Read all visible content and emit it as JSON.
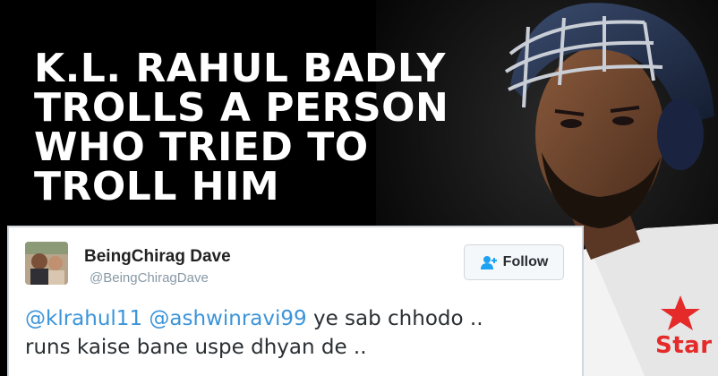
{
  "headline": {
    "lines": [
      "K.L. RAHUL BADLY",
      "TROLLS A PERSON",
      "WHO TRIED TO",
      "TROLL HIM"
    ]
  },
  "tweet": {
    "display_name": "BeingChirag Dave",
    "handle": "@BeingChiragDave",
    "follow_label": "Follow",
    "mention_1": "@klrahul11",
    "mention_2": "@ashwinravi99",
    "text_1": " ye sab chhodo ..",
    "text_2": "runs kaise bane uspe dhyan de .."
  },
  "photo": {
    "jersey_logo_text": "Star"
  },
  "colors": {
    "background": "#000000",
    "headline": "#ffffff",
    "mention": "#3b94d9",
    "logo_red": "#e52a2a"
  }
}
